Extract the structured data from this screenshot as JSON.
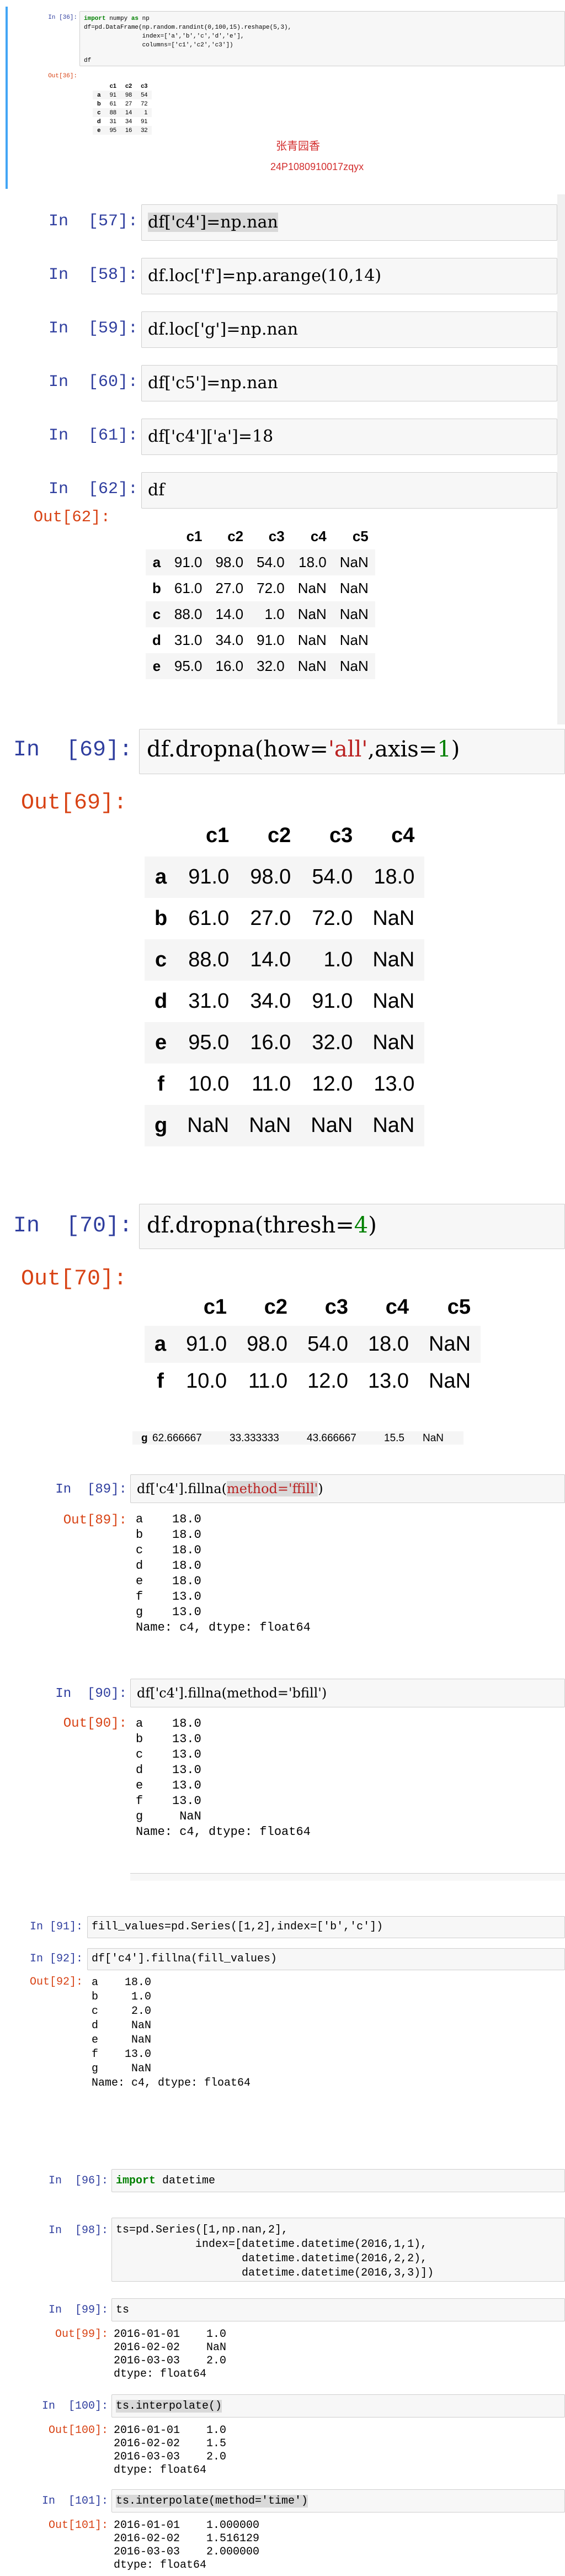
{
  "colors": {
    "prompt_in": "#303f9f",
    "prompt_out": "#d84315",
    "keyword": "#008000",
    "string": "#ba2121",
    "watermark": "#d32f2f",
    "selected_cell_bar": "#42a5f5"
  },
  "p1": {
    "in_prompt": "In [36]:",
    "out_prompt": "Out[36]:",
    "code_l1_kw1": "import",
    "code_l1_mid": " numpy ",
    "code_l1_kw2": "as",
    "code_l1_end": " np",
    "code_l2": "df=pd.DataFrame(np.random.randint(0,100,15).reshape(5,3),",
    "code_l3": "                index=['a','b','c','d','e'],",
    "code_l4": "                columns=['c1','c2','c3'])",
    "code_l5": "df",
    "watermark_name": "张青园香",
    "watermark_id": "24P1080910017zqyx",
    "table": {
      "columns": [
        "",
        "c1",
        "c2",
        "c3"
      ],
      "rows": [
        [
          "a",
          "91",
          "98",
          "54"
        ],
        [
          "b",
          "61",
          "27",
          "72"
        ],
        [
          "c",
          "88",
          "14",
          "1"
        ],
        [
          "d",
          "31",
          "34",
          "91"
        ],
        [
          "e",
          "95",
          "16",
          "32"
        ]
      ]
    }
  },
  "p2": {
    "cells": [
      {
        "prompt": "In  [57]:",
        "code": "df['c4']=np.nan"
      },
      {
        "prompt": "In  [58]:",
        "code": "df.loc['f']=np.arange(10,14)"
      },
      {
        "prompt": "In  [59]:",
        "code": "df.loc['g']=np.nan"
      },
      {
        "prompt": "In  [60]:",
        "code": "df['c5']=np.nan"
      },
      {
        "prompt": "In  [61]:",
        "code": "df['c4']['a']=18"
      },
      {
        "prompt": "In  [62]:",
        "code": "df"
      }
    ],
    "out_prompt": "Out[62]:",
    "table": {
      "columns": [
        "",
        "c1",
        "c2",
        "c3",
        "c4",
        "c5"
      ],
      "rows": [
        [
          "a",
          "91.0",
          "98.0",
          "54.0",
          "18.0",
          "NaN"
        ],
        [
          "b",
          "61.0",
          "27.0",
          "72.0",
          "NaN",
          "NaN"
        ],
        [
          "c",
          "88.0",
          "14.0",
          "1.0",
          "NaN",
          "NaN"
        ],
        [
          "d",
          "31.0",
          "34.0",
          "91.0",
          "NaN",
          "NaN"
        ],
        [
          "e",
          "95.0",
          "16.0",
          "32.0",
          "NaN",
          "NaN"
        ]
      ]
    }
  },
  "p3": {
    "in_prompt": "In  [69]:",
    "code_a": "df.dropna(how=",
    "code_str": "'all'",
    "code_b": ",axis=",
    "code_num": "1",
    "code_c": ")",
    "out_prompt": "Out[69]:",
    "table": {
      "columns": [
        "",
        "c1",
        "c2",
        "c3",
        "c4"
      ],
      "rows": [
        [
          "a",
          "91.0",
          "98.0",
          "54.0",
          "18.0"
        ],
        [
          "b",
          "61.0",
          "27.0",
          "72.0",
          "NaN"
        ],
        [
          "c",
          "88.0",
          "14.0",
          "1.0",
          "NaN"
        ],
        [
          "d",
          "31.0",
          "34.0",
          "91.0",
          "NaN"
        ],
        [
          "e",
          "95.0",
          "16.0",
          "32.0",
          "NaN"
        ],
        [
          "f",
          "10.0",
          "11.0",
          "12.0",
          "13.0"
        ],
        [
          "g",
          "NaN",
          "NaN",
          "NaN",
          "NaN"
        ]
      ]
    }
  },
  "p4": {
    "in_prompt": "In  [70]:",
    "code_a": "df.dropna(thresh=",
    "code_num": "4",
    "code_c": ")",
    "out_prompt": "Out[70]:",
    "table": {
      "columns": [
        "",
        "c1",
        "c2",
        "c3",
        "c4",
        "c5"
      ],
      "rows": [
        [
          "a",
          "91.0",
          "98.0",
          "54.0",
          "18.0",
          "NaN"
        ],
        [
          "f",
          "10.0",
          "11.0",
          "12.0",
          "13.0",
          "NaN"
        ]
      ]
    }
  },
  "p5": {
    "partial_row": [
      "g",
      "62.666667",
      "33.333333",
      "43.666667",
      "15.5",
      "NaN"
    ],
    "c89_prompt": "In  [89]:",
    "c89_code_a": "df['c4'].fillna(",
    "c89_code_hl": "method='ffill'",
    "c89_code_c": ")",
    "c89_out_prompt": "Out[89]:",
    "c89_out": "a    18.0\nb    18.0\nc    18.0\nd    18.0\ne    18.0\nf    13.0\ng    13.0\nName: c4, dtype: float64",
    "c90_prompt": "In  [90]:",
    "c90_code": "df['c4'].fillna(method='bfill')",
    "c90_out_prompt": "Out[90]:",
    "c90_out": "a    18.0\nb    13.0\nc    13.0\nd    13.0\ne    13.0\nf    13.0\ng     NaN\nName: c4, dtype: float64"
  },
  "p6": {
    "c91_prompt": "In [91]:",
    "c91_code": "fill_values=pd.Series([1,2],index=['b','c'])",
    "c92_prompt": "In [92]:",
    "c92_code": "df['c4'].fillna(fill_values)",
    "c92_out_prompt": "Out[92]:",
    "c92_out": "a    18.0\nb     1.0\nc     2.0\nd     NaN\ne     NaN\nf    13.0\ng     NaN\nName: c4, dtype: float64"
  },
  "p7": {
    "c96_prompt": "In  [96]:",
    "c96_kw": "import",
    "c96_rest": " datetime",
    "c98_prompt": "In  [98]:",
    "c98_code": "ts=pd.Series([1,np.nan,2],\n            index=[datetime.datetime(2016,1,1),\n                   datetime.datetime(2016,2,2),\n                   datetime.datetime(2016,3,3)])",
    "c99_prompt": "In  [99]:",
    "c99_code": "ts",
    "c99_out_prompt": "Out[99]:",
    "c99_out": "2016-01-01    1.0\n2016-02-02    NaN\n2016-03-03    2.0\ndtype: float64",
    "c100_prompt": "In  [100]:",
    "c100_code": "ts.interpolate()",
    "c100_out_prompt": "Out[100]:",
    "c100_out": "2016-01-01    1.0\n2016-02-02    1.5\n2016-03-03    2.0\ndtype: float64",
    "c101_prompt": "In  [101]:",
    "c101_code": "ts.interpolate(method='time')",
    "c101_out_prompt": "Out[101]:",
    "c101_out": "2016-01-01    1.000000\n2016-02-02    1.516129\n2016-03-03    2.000000\ndtype: float64"
  }
}
